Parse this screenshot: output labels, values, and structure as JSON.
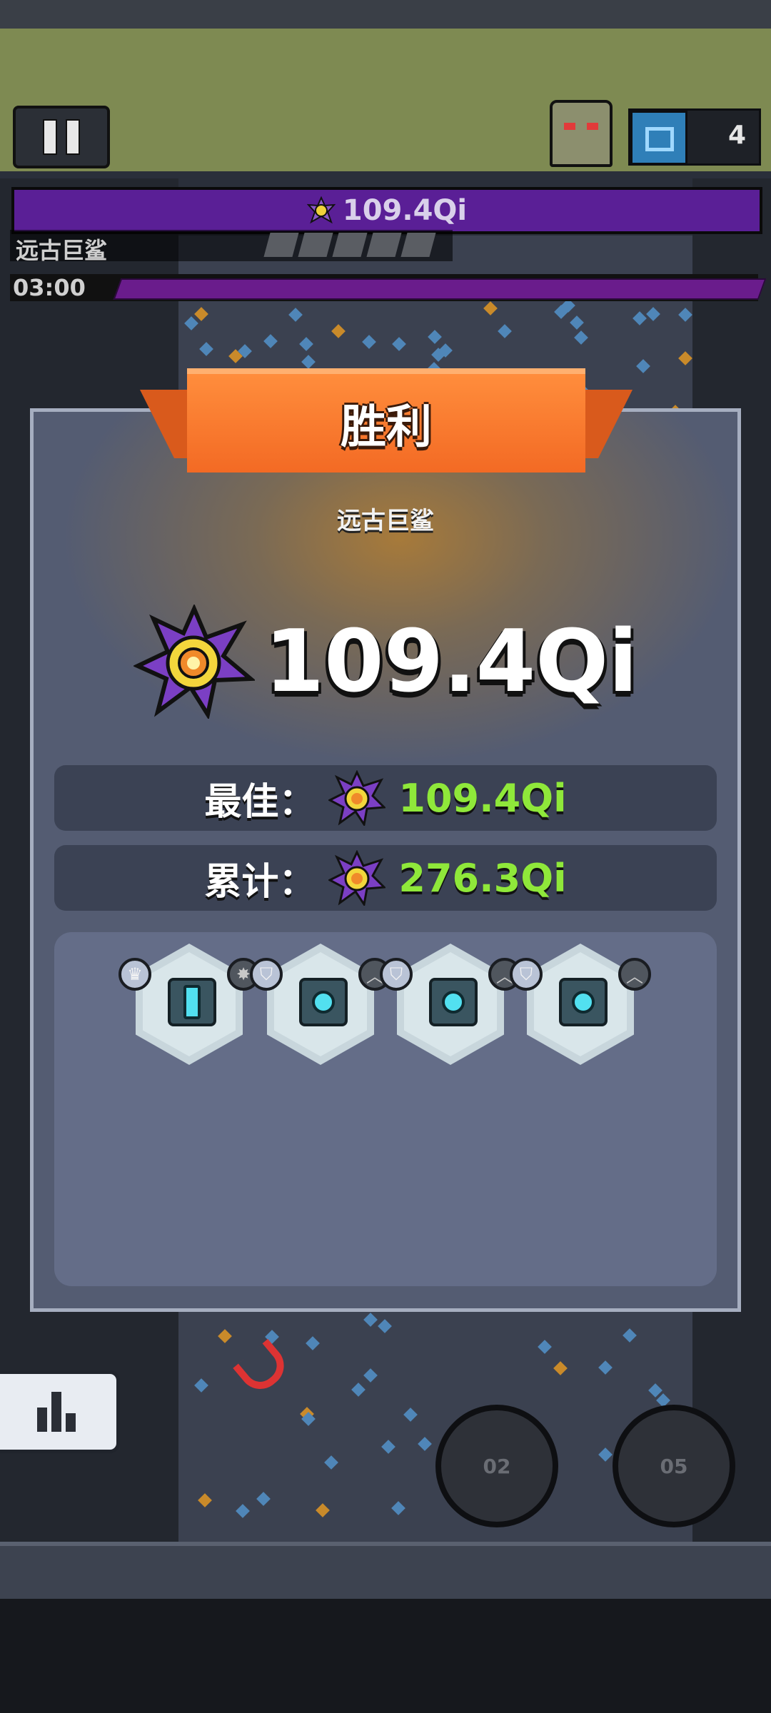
{
  "hud": {
    "pause_icon": "pause-icon",
    "chest_count": "4",
    "boss_hp_value": "109.4Qi",
    "boss_hp_fill": 1.0,
    "boss_name": "远古巨鲨",
    "timer": "03:00"
  },
  "result": {
    "title": "胜利",
    "boss_name": "远古巨鲨",
    "damage": "109.4Qi",
    "best_label": "最佳：",
    "best_value": "109.4Qi",
    "total_label": "累计：",
    "total_value": "276.3Qi"
  },
  "turrets": [
    {
      "name": "twin-cannon-turret",
      "left_badge": "crown-badge",
      "right_badge": "rank-badge"
    },
    {
      "name": "laser-turret",
      "left_badge": "shield-badge",
      "right_badge": "upgrade-badge"
    },
    {
      "name": "laser-turret",
      "left_badge": "shield-badge",
      "right_badge": "upgrade-badge"
    },
    {
      "name": "laser-turret",
      "left_badge": "shield-badge",
      "right_badge": "upgrade-badge"
    }
  ],
  "bottom": {
    "stats_icon": "bar-chart-icon",
    "skill_1": "02",
    "skill_2": "05"
  },
  "colors": {
    "ribbon": "#f36a24",
    "panel": "#545c72",
    "value_green": "#8fe83a",
    "boss_bar": "#3f1670"
  }
}
